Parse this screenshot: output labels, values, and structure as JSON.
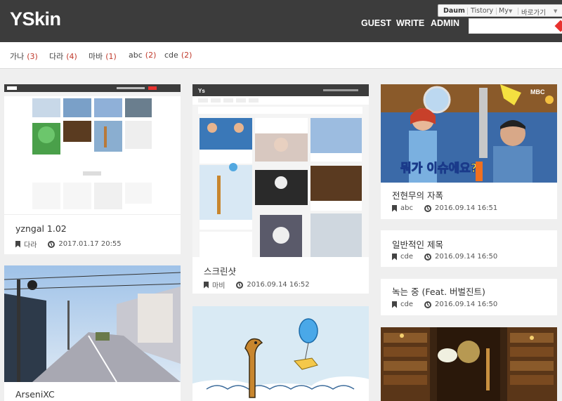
{
  "brand": "YSkin",
  "nav": [
    "GUEST",
    "WRITE",
    "ADMIN"
  ],
  "tistory_bar": {
    "daum": "Daum",
    "tistory": "Tistory",
    "my": "My",
    "shortcut": "바로가기"
  },
  "search": {
    "placeholder": ""
  },
  "categories": [
    {
      "name": "가나",
      "count": "(3)"
    },
    {
      "name": "다라",
      "count": "(4)"
    },
    {
      "name": "마바",
      "count": "(1)"
    },
    {
      "name": "abc",
      "count": "(2)"
    },
    {
      "name": "cde",
      "count": "(2)"
    }
  ],
  "posts": [
    {
      "title": "yzngal 1.02",
      "category": "다라",
      "date": "2017.01.17 20:55"
    },
    {
      "title": "ArseniXC",
      "category": "",
      "date": ""
    },
    {
      "title": "스크린샷",
      "category": "마비",
      "date": "2016.09.14 16:52"
    },
    {
      "title": "전현무의 자폭",
      "category": "abc",
      "date": "2016.09.14 16:51"
    },
    {
      "title": "일반적인 제목",
      "category": "cde",
      "date": "2016.09.14 16:50"
    },
    {
      "title": "녹는 중 (Feat. 버벌진트)",
      "category": "cde",
      "date": "2016.09.14 16:50"
    }
  ],
  "thumb_text": {
    "mini_brand": "Ys",
    "tv_caption": "뭐가 이슈에요?",
    "tv_logo": "MBC"
  },
  "colors": {
    "header": "#3c3c3c",
    "accent": "#e8322f",
    "count": "#c0392b"
  }
}
